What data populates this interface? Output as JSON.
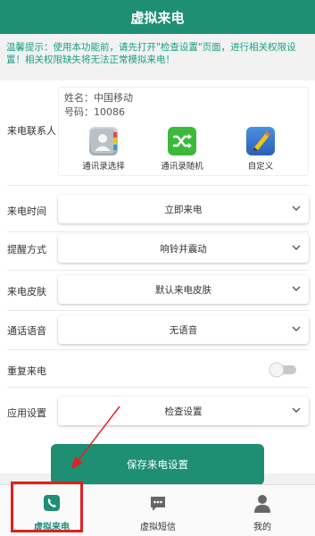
{
  "header": {
    "title": "虚拟来电"
  },
  "tip": {
    "text": "温馨提示：使用本功能前，请先打开\"检查设置\"页面，进行相关权限设置！相关权限缺失将无法正常模拟来电！"
  },
  "contact": {
    "label": "来电联系人",
    "name": "姓名：中国移动",
    "number": "号码：10086",
    "actions": [
      {
        "label": "通讯录选择",
        "icon": "address-book-icon"
      },
      {
        "label": "通讯录随机",
        "icon": "shuffle-icon"
      },
      {
        "label": "自定义",
        "icon": "pencil-icon"
      }
    ]
  },
  "settings": [
    {
      "label": "来电时间",
      "value": "立即来电"
    },
    {
      "label": "提醒方式",
      "value": "响铃并震动"
    },
    {
      "label": "来电皮肤",
      "value": "默认来电皮肤"
    },
    {
      "label": "通话语音",
      "value": "无语音"
    }
  ],
  "repeat": {
    "label": "重复来电",
    "enabled": false
  },
  "app_settings": {
    "label": "应用设置",
    "value": "检查设置"
  },
  "save_button": "保存来电设置",
  "tabs": [
    {
      "label": "虚拟来电",
      "active": true
    },
    {
      "label": "虚拟短信",
      "active": false
    },
    {
      "label": "我的",
      "active": false
    }
  ],
  "colors": {
    "primary": "#1e8f73",
    "tip": "#18a080",
    "highlight": "#e02020"
  }
}
